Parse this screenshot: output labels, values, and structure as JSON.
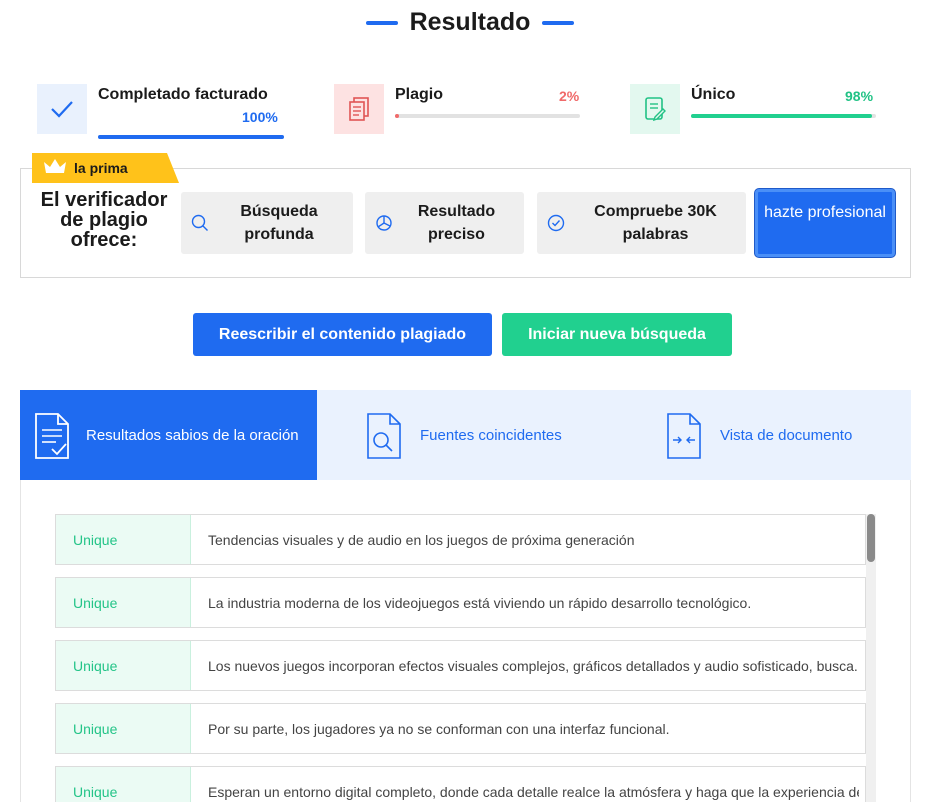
{
  "header": {
    "title": "Resultado"
  },
  "colors": {
    "primary": "#1f6bf0",
    "green": "#21d08f",
    "red": "#f06a6a",
    "premium": "#ffc21a"
  },
  "stats": [
    {
      "label": "Completado facturado",
      "value": "100%",
      "progress": 1.0,
      "icon": "check-icon",
      "color": "#1f6bf0"
    },
    {
      "label": "Plagio",
      "value": "2%",
      "progress": 0.02,
      "icon": "document-copy-icon",
      "color": "#f06a6a"
    },
    {
      "label": "Único",
      "value": "98%",
      "progress": 0.98,
      "icon": "document-edit-icon",
      "color": "#21d08f"
    }
  ],
  "premium": {
    "badge": "la prima",
    "title": "El verificador de plagio ofrece:",
    "features": [
      {
        "label": "Búsqueda profunda",
        "icon": "search-icon"
      },
      {
        "label": "Resultado preciso",
        "icon": "pie-chart-icon"
      },
      {
        "label": "Compruebe 30K palabras",
        "icon": "check-circle-icon"
      }
    ],
    "cta": "hazte profesional"
  },
  "actions": {
    "rewrite": "Reescribir el contenido plagiado",
    "new_search": "Iniciar nueva búsqueda"
  },
  "tabs": [
    {
      "label": "Resultados sabios de la oración",
      "icon": "document-check-icon",
      "active": true
    },
    {
      "label": "Fuentes coincidentes",
      "icon": "document-search-icon",
      "active": false
    },
    {
      "label": "Vista de documento",
      "icon": "document-compare-icon",
      "active": false
    }
  ],
  "results": [
    {
      "status": "Unique",
      "text": "Tendencias visuales y de audio en los juegos de próxima generación"
    },
    {
      "status": "Unique",
      "text": "La industria moderna de los videojuegos está viviendo un rápido desarrollo tecnológico."
    },
    {
      "status": "Unique",
      "text": "Los nuevos juegos incorporan efectos visuales complejos, gráficos detallados y audio sofisticado, busca..."
    },
    {
      "status": "Unique",
      "text": "Por su parte, los jugadores ya no se conforman con una interfaz funcional."
    },
    {
      "status": "Unique",
      "text": "Esperan un entorno digital completo, donde cada detalle realce la atmósfera y haga que la experiencia de..."
    }
  ]
}
